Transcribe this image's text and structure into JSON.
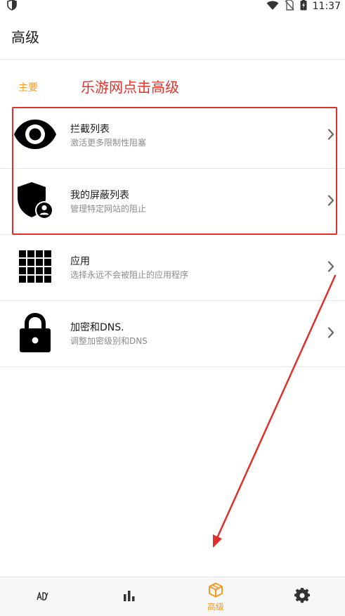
{
  "status_bar": {
    "time": "11:37"
  },
  "app_bar": {
    "title": "高级"
  },
  "section": {
    "title": "主要",
    "annotation": "乐游网点击高级"
  },
  "items": [
    {
      "label": "拦截列表",
      "sub": "激活更多限制性阻塞",
      "icon": "eye-icon"
    },
    {
      "label": "我的屏蔽列表",
      "sub": "管理特定网站的阻止",
      "icon": "shield-user-icon"
    },
    {
      "label": "应用",
      "sub": "选择永远不会被阻止的应用程序",
      "icon": "apps-grid-icon"
    },
    {
      "label": "加密和DNS.",
      "sub": "调整加密级别和DNS",
      "icon": "lock-icon"
    }
  ],
  "bottom_nav": {
    "items": [
      {
        "icon": "ad-block-icon",
        "label": ""
      },
      {
        "icon": "bar-chart-icon",
        "label": ""
      },
      {
        "icon": "cube-icon",
        "label": "高级",
        "active": true
      },
      {
        "icon": "gear-icon",
        "label": ""
      }
    ]
  },
  "colors": {
    "accent": "#f59a23",
    "annotation": "#e8302a",
    "text": "#1a1a1a",
    "subtext": "#8c8c8c"
  }
}
